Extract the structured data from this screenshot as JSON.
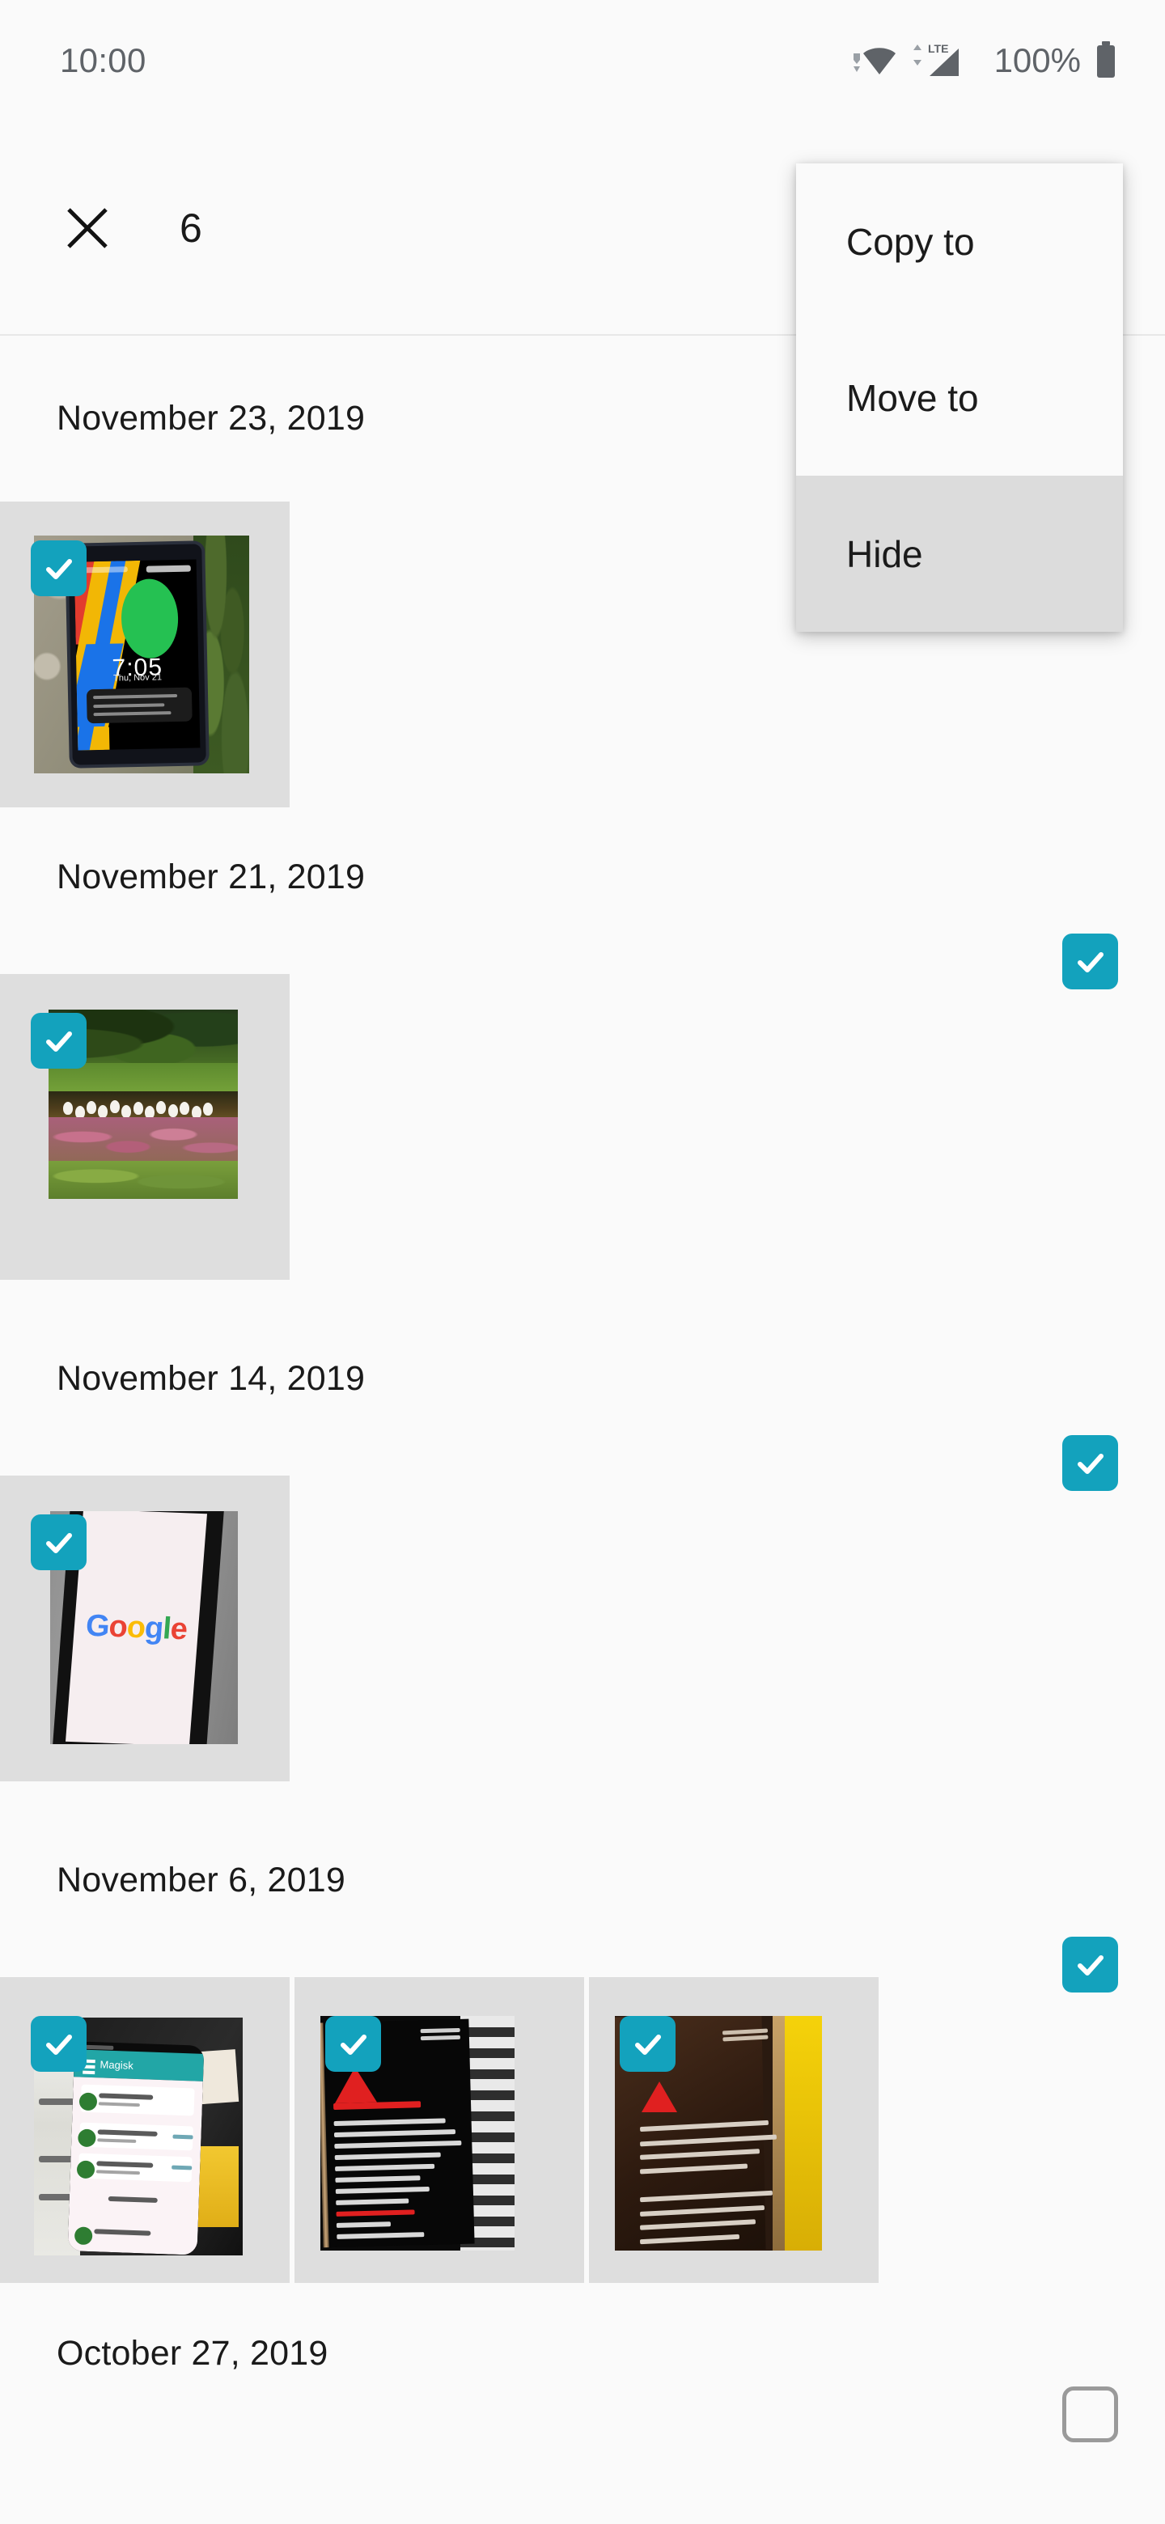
{
  "status_bar": {
    "time": "10:00",
    "battery_percent": "100%",
    "network_label": "LTE",
    "icons": [
      "wifi-icon",
      "lte-signal-icon",
      "battery-icon"
    ]
  },
  "app_bar": {
    "close_label": "✕",
    "selection_count": "6",
    "close_icon": "close-icon"
  },
  "overflow_menu": {
    "items": [
      {
        "label": "Copy to",
        "pressed": false
      },
      {
        "label": "Move to",
        "pressed": false
      },
      {
        "label": "Hide",
        "pressed": true
      }
    ]
  },
  "theme": {
    "accent": "#13a2bd",
    "background": "#fafafa",
    "tile_background": "#dedede",
    "menu_pressed": "#dcdcdc",
    "text_primary": "#1a1a1a",
    "text_secondary": "#5f6368",
    "checkbox_outline": "#9a9a9a"
  },
  "groups": [
    {
      "date": "November 23, 2019",
      "group_checkbox": {
        "visible": false,
        "checked": false
      },
      "items": [
        {
          "name": "pixel-4-lockscreen-photo",
          "selected": true,
          "art": "pixel"
        }
      ]
    },
    {
      "date": "November 21, 2019",
      "group_checkbox": {
        "visible": true,
        "checked": true
      },
      "items": [
        {
          "name": "pond-geese-photo",
          "selected": true,
          "art": "pond"
        }
      ]
    },
    {
      "date": "November 14, 2019",
      "group_checkbox": {
        "visible": true,
        "checked": true
      },
      "items": [
        {
          "name": "google-homepage-photo",
          "selected": true,
          "art": "google"
        }
      ]
    },
    {
      "date": "November 6, 2019",
      "group_checkbox": {
        "visible": true,
        "checked": true
      },
      "items": [
        {
          "name": "magisk-manager-photo",
          "selected": true,
          "art": "magisk"
        },
        {
          "name": "fastboot-mode-photo",
          "selected": true,
          "art": "fastboot"
        },
        {
          "name": "bootloader-unlock-warning-photo",
          "selected": true,
          "art": "unlock"
        }
      ]
    },
    {
      "date": "October 27, 2019",
      "group_checkbox": {
        "visible": true,
        "checked": false
      },
      "items": []
    }
  ],
  "photo_content": {
    "pixel": {
      "clock": "7:05",
      "subtitle": "Thu, Nov 21"
    },
    "google": {
      "logo_letters": [
        "G",
        "o",
        "o",
        "g",
        "l",
        "e"
      ]
    },
    "magisk": {
      "app_title": "Magisk"
    }
  }
}
